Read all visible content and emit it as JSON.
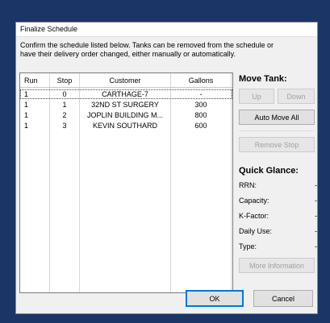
{
  "window": {
    "title": "Finalize Schedule"
  },
  "instructions": {
    "line1": "Confirm the schedule listed below.  Tanks can be removed from the schedule or",
    "line2": "have their delivery order changed, either manually or automatically."
  },
  "table": {
    "columns": {
      "run": "Run",
      "stop": "Stop",
      "customer": "Customer",
      "gallons": "Gallons"
    },
    "rows": [
      {
        "run": "1",
        "stop": "0",
        "customer": "CARTHAGE-7",
        "gallons": "-"
      },
      {
        "run": "1",
        "stop": "1",
        "customer": "32ND ST SURGERY",
        "gallons": "300"
      },
      {
        "run": "1",
        "stop": "2",
        "customer": "JOPLIN BUILDING M...",
        "gallons": "800"
      },
      {
        "run": "1",
        "stop": "3",
        "customer": "KEVIN SOUTHARD",
        "gallons": "600"
      }
    ]
  },
  "move_tank": {
    "label": "Move Tank:",
    "up_label": "Up",
    "down_label": "Down",
    "auto_move_all_label": "Auto Move All",
    "remove_stop_label": "Remove Stop"
  },
  "quick_glance": {
    "label": "Quick Glance:",
    "rrn_label": "RRN:",
    "rrn_value": "-",
    "capacity_label": "Capacity:",
    "capacity_value": "-",
    "kfactor_label": "K-Factor:",
    "kfactor_value": "-",
    "daily_use_label": "Daily Use:",
    "daily_use_value": "-",
    "type_label": "Type:",
    "type_value": "-",
    "more_info_label": "More Information"
  },
  "footer": {
    "ok_label": "OK",
    "cancel_label": "Cancel"
  },
  "colors": {
    "background": "#1a3566",
    "dialog": "#f0f0f0",
    "accent": "#0078d7"
  }
}
